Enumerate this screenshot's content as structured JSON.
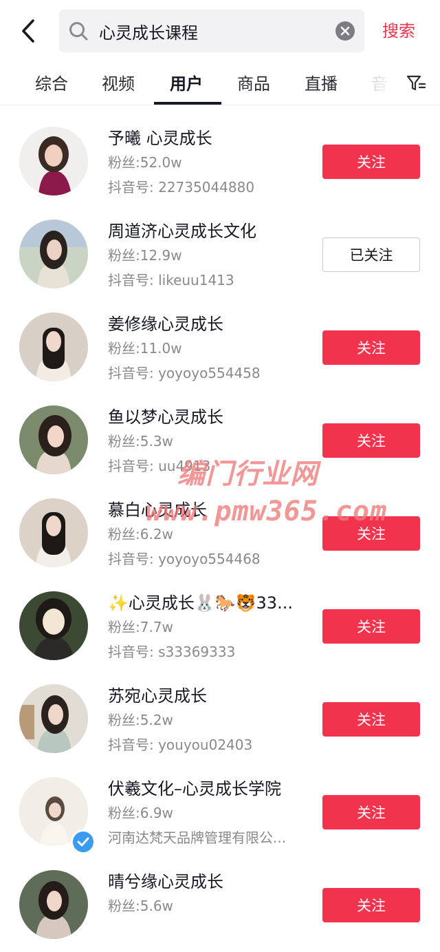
{
  "search": {
    "query": "心灵成长课程",
    "button_label": "搜索"
  },
  "tabs": [
    {
      "label": "综合",
      "active": false
    },
    {
      "label": "视频",
      "active": false
    },
    {
      "label": "用户",
      "active": true
    },
    {
      "label": "商品",
      "active": false
    },
    {
      "label": "直播",
      "active": false
    },
    {
      "label": "音",
      "active": false
    }
  ],
  "colors": {
    "accent": "#f2334d",
    "verified": "#3a9bf0",
    "secondary_text": "#88898f"
  },
  "users": [
    {
      "name": "予曦 心灵成长",
      "fans": "粉丝:52.0w",
      "uid": "抖音号: 22735044880",
      "button": "关注",
      "followed": false,
      "verified": false
    },
    {
      "name": "周道济心灵成长文化",
      "fans": "粉丝:12.9w",
      "uid": "抖音号: likeuu1413",
      "button": "已关注",
      "followed": true,
      "verified": false
    },
    {
      "name": "姜修缘心灵成长",
      "fans": "粉丝:11.0w",
      "uid": "抖音号: yoyoyo554458",
      "button": "关注",
      "followed": false,
      "verified": false
    },
    {
      "name": "鱼以梦心灵成长",
      "fans": "粉丝:5.3w",
      "uid": "抖音号: uu4913",
      "button": "关注",
      "followed": false,
      "verified": false
    },
    {
      "name": "慕白心灵成长",
      "fans": "粉丝:6.2w",
      "uid": "抖音号: yoyoyo554468",
      "button": "关注",
      "followed": false,
      "verified": false
    },
    {
      "name": "✨心灵成长🐰🐎🐯33...",
      "fans": "粉丝:7.7w",
      "uid": "抖音号: s33369333",
      "button": "关注",
      "followed": false,
      "verified": false
    },
    {
      "name": "苏宛心灵成长",
      "fans": "粉丝:5.2w",
      "uid": "抖音号: youyou02403",
      "button": "关注",
      "followed": false,
      "verified": false
    },
    {
      "name": "伏羲文化–心灵成长学院",
      "fans": "粉丝:6.9w",
      "uid": "河南达梵天品牌管理有限公...",
      "button": "关注",
      "followed": false,
      "verified": true
    },
    {
      "name": "晴兮缘心灵成长",
      "fans": "粉丝:5.6w",
      "uid": "",
      "button": "关注",
      "followed": false,
      "verified": false
    }
  ],
  "watermark": {
    "line1": "编门行业网",
    "line2": "www.pmw365.com"
  }
}
